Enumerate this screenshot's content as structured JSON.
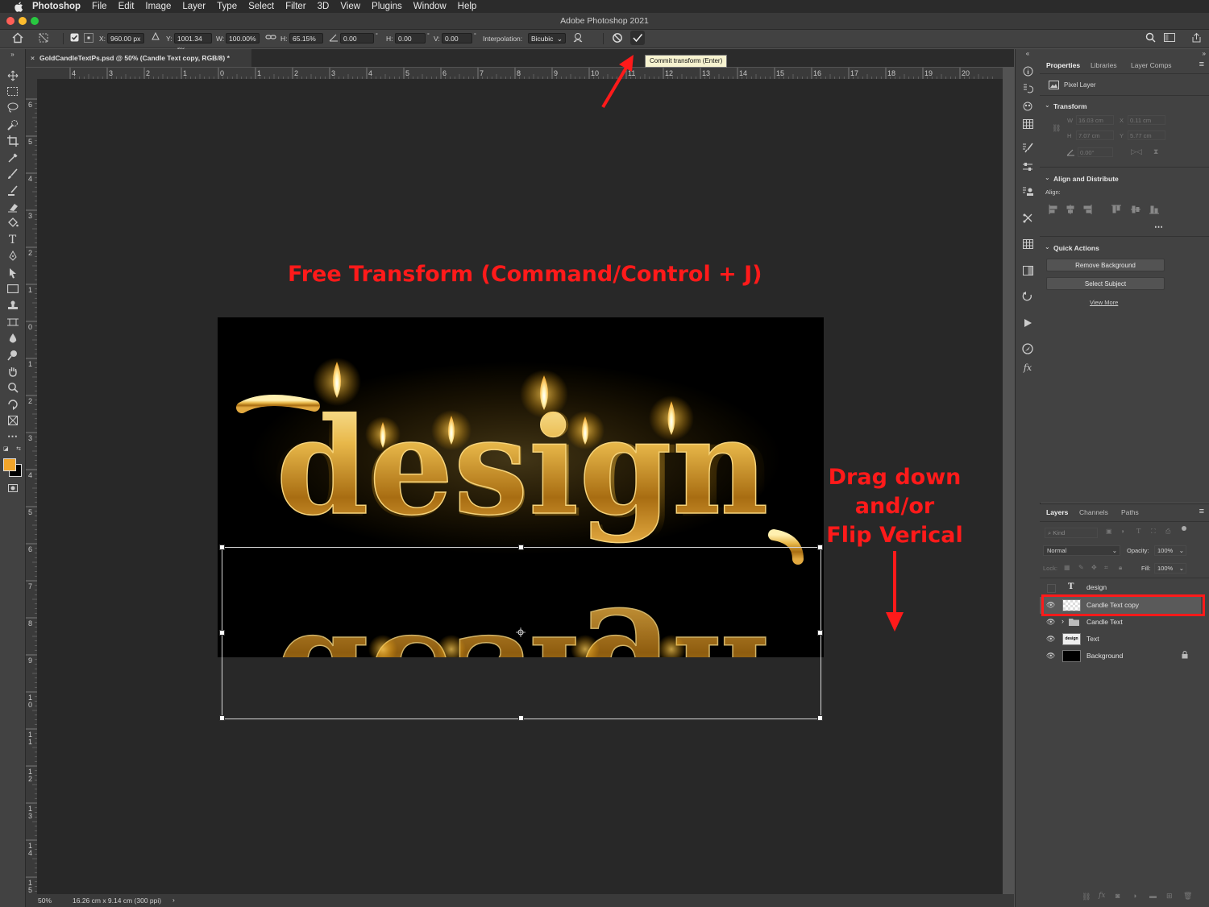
{
  "menubar": {
    "app": "Photoshop",
    "items": [
      "File",
      "Edit",
      "Image",
      "Layer",
      "Type",
      "Select",
      "Filter",
      "3D",
      "View",
      "Plugins",
      "Window",
      "Help"
    ]
  },
  "window": {
    "title": "Adobe Photoshop 2021"
  },
  "options": {
    "x_label": "X:",
    "x_value": "960.00 px",
    "y_label": "Y:",
    "y_value": "1001.34 px",
    "w_label": "W:",
    "w_value": "100.00%",
    "h_label": "H:",
    "h_value": "65.15%",
    "angle_value": "0.00",
    "hskew_label": "H:",
    "hskew_value": "0.00",
    "vskew_label": "V:",
    "vskew_value": "0.00",
    "interp_label": "Interpolation:",
    "interp_value": "Bicubic"
  },
  "tooltip": "Commit transform (Enter)",
  "document": {
    "tab_title": "GoldCandleTextPs.psd @ 50% (Candle Text copy, RGB/8) *",
    "zoom": "50%",
    "doc_info": "16.26 cm x 9.14 cm (300 ppi)"
  },
  "rulers": {
    "h_ticks": [
      "4",
      "3",
      "2",
      "1",
      "0",
      "1",
      "2",
      "3",
      "4",
      "5",
      "6",
      "7",
      "8",
      "9",
      "10",
      "11",
      "12",
      "13",
      "14",
      "15",
      "16",
      "17",
      "18",
      "19",
      "20"
    ],
    "v_ticks": [
      "6",
      "5",
      "4",
      "3",
      "2",
      "1",
      "0",
      "1",
      "2",
      "3",
      "4",
      "5",
      "6",
      "7",
      "8",
      "9",
      "10",
      "11",
      "12",
      "13",
      "14",
      "15"
    ]
  },
  "artwork": {
    "word": "design"
  },
  "annotations": {
    "free_transform": "Free Transform (Command/Control + J)",
    "drag_line1": "Drag down",
    "drag_line2": "and/or",
    "drag_line3": "Flip Verical",
    "color": "#ff1a1a"
  },
  "properties": {
    "tabs": [
      "Properties",
      "Libraries",
      "Layer Comps"
    ],
    "layer_type": "Pixel Layer",
    "transform_title": "Transform",
    "w_label": "W",
    "w_value": "16.03 cm",
    "x_label": "X",
    "x_value": "0.11 cm",
    "h_label": "H",
    "h_value": "7.07 cm",
    "y_label": "Y",
    "y_value": "5.77 cm",
    "angle_value": "0.00°",
    "align_title": "Align and Distribute",
    "align_label": "Align:",
    "quick_title": "Quick Actions",
    "remove_bg": "Remove Background",
    "select_subject": "Select Subject",
    "view_more": "View More"
  },
  "layers_panel": {
    "tabs": [
      "Layers",
      "Channels",
      "Paths"
    ],
    "kind": "Kind",
    "blend": "Normal",
    "opacity_label": "Opacity:",
    "opacity_value": "100%",
    "lock_label": "Lock:",
    "fill_label": "Fill:",
    "fill_value": "100%",
    "layers": [
      {
        "name": "design",
        "type": "text"
      },
      {
        "name": "Candle Text copy",
        "type": "pixel",
        "selected": true
      },
      {
        "name": "Candle Text",
        "type": "group"
      },
      {
        "name": "Text",
        "type": "pixel"
      },
      {
        "name": "Background",
        "type": "background"
      }
    ]
  }
}
